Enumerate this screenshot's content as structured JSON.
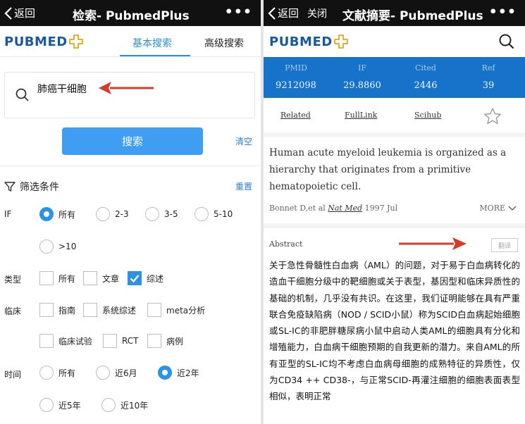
{
  "left": {
    "topbar": {
      "back_label": "返回",
      "title": "检索- PubmedPlus",
      "more": "•••"
    },
    "logo": "PUBMED",
    "tabs": [
      {
        "label": "基本搜索"
      },
      {
        "label": "高级搜索"
      }
    ],
    "search": {
      "value": "肺癌干细胞"
    },
    "search_button": "搜索",
    "clear_button": "清空",
    "filter": {
      "title": "筛选条件",
      "reset": "重置",
      "if": {
        "label": "IF",
        "options": [
          "所有",
          "2-3",
          "3-5",
          "5-10",
          ">10"
        ],
        "selected": "所有"
      },
      "type": {
        "label": "类型",
        "options": [
          "所有",
          "文章",
          "综述"
        ],
        "checked": [
          "综述"
        ]
      },
      "clinical": {
        "label": "临床",
        "options": [
          "指南",
          "系统综述",
          "meta分析",
          "临床试验",
          "RCT",
          "病例"
        ],
        "checked": []
      },
      "time": {
        "label": "时间",
        "options": [
          "所有",
          "近6月",
          "近2年",
          "近5年",
          "近10年"
        ],
        "selected": "近2年"
      }
    },
    "colors": {
      "accent": "#2a93e6",
      "arrow": "#d93b2b"
    }
  },
  "right": {
    "topbar": {
      "back_label": "返回",
      "close_label": "关闭",
      "title": "文献摘要- PubmedPlus",
      "more": "•••"
    },
    "logo": "PUBMED",
    "stats": [
      {
        "key": "PMID",
        "value": "9212098"
      },
      {
        "key": "IF",
        "value": "29.8860"
      },
      {
        "key": "Cited",
        "value": "2446"
      },
      {
        "key": "Ref",
        "value": "39"
      }
    ],
    "links": [
      "Related",
      "FullLink",
      "Scihub"
    ],
    "summary": {
      "text": "Human acute myeloid leukemia is organized as a hierarchy that originates from a primitive hematopoietic cell.",
      "authors": "Bonnet D,et al",
      "journal": "Nat Med",
      "year": "1997 Jul",
      "more": "MORE"
    },
    "abstract": {
      "title": "Abstract",
      "translate": "翻译",
      "text": "关于急性骨髓性白血病（AML）的问题，对于易于白血病转化的造血干细胞分级中的靶细胞或关于表型，基因型和临床异质性的基础的机制，几乎没有共识。在这里，我们证明能够在具有严重联合免疫缺陷病（NOD / SCID小鼠）称为SCID白血病起始细胞或SL-IC的非肥胖糖尿病小鼠中启动人类AML的细胞具有分化和增殖能力，白血病干细胞预期的自我更新的潜力。来自AML的所有亚型的SL-IC均不考虑白血病母细胞的成熟特征的异质性，仅为CD34 ++ CD38-，与正常SCID-再灌注细胞的细胞表面表型相似，表明正常"
    },
    "colors": {
      "stats_bg": "#1673c9"
    }
  }
}
